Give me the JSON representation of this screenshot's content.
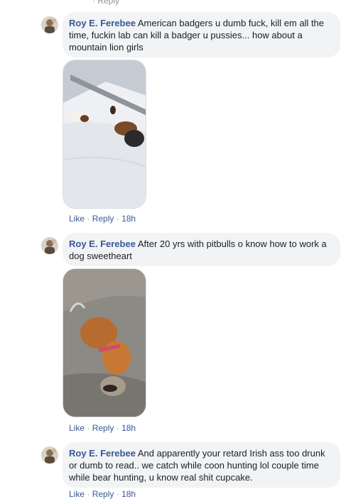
{
  "top_fragment": "Reply",
  "comments": [
    {
      "author": "Roy E. Ferebee",
      "text": "American badgers u dumb fuck, kill em all the time, fuckin lab can kill a badger u pussies... how about a mountain lion girls",
      "has_media": true,
      "media_description": "dogs-in-snow-photo",
      "like": "Like",
      "reply": "Reply",
      "time": "18h"
    },
    {
      "author": "Roy E. Ferebee",
      "text": "After 20 yrs with pitbulls o know how to work a dog sweetheart",
      "has_media": true,
      "media_description": "dog-with-raccoon-photo",
      "like": "Like",
      "reply": "Reply",
      "time": "18h"
    },
    {
      "author": "Roy E. Ferebee",
      "text": "And apparently your retard Irish ass too drunk or dumb to read.. we catch while coon hunting lol couple time while bear hunting, u know real shit cupcake.",
      "has_media": false,
      "like": "Like",
      "reply": "Reply",
      "time": "18h"
    }
  ],
  "separator": "·"
}
